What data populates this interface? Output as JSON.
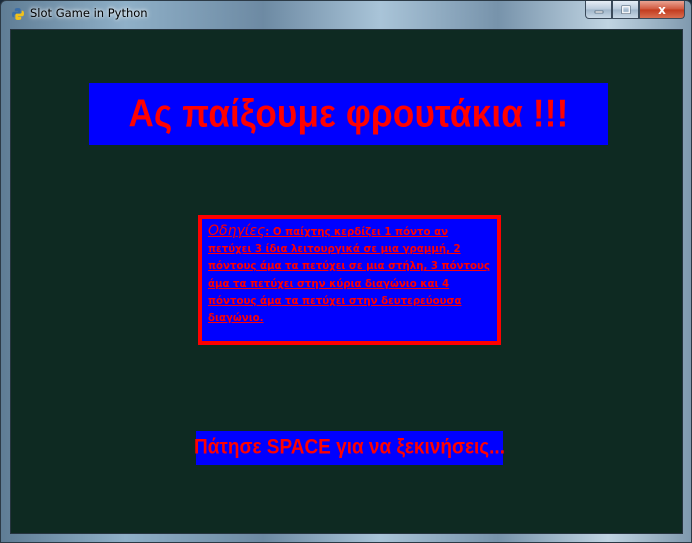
{
  "window": {
    "title": "Slot Game in Python",
    "close_label": "x"
  },
  "game": {
    "heading": "Ας παίξουμε φρουτάκια !!!",
    "instructions_label": "Οδηγίες",
    "instructions_text": ": Ο παίχτης κερδίζει 1 πόντο αν πετύχει 3 ίδια λειτουργικά σε μια γραμμή, 2 πόντους άμα τα πετύχει σε μια στήλη, 3 πόντους άμα τα πετύχει στην κύρια διαγώνιο και 4 πόντους άμα τα πετύχει στην δευτερεύουσα διαγώνιο.",
    "start_prompt": "Πάτησε SPACE για να ξεκινήσεις..."
  },
  "colors": {
    "background": "#0e2a22",
    "banner": "#0000ff",
    "text": "#ff0000",
    "close_button": "#c23a1d"
  },
  "icons": {
    "app": "python-icon",
    "minimize": "minimize-icon",
    "maximize": "maximize-icon",
    "close": "close-icon"
  }
}
